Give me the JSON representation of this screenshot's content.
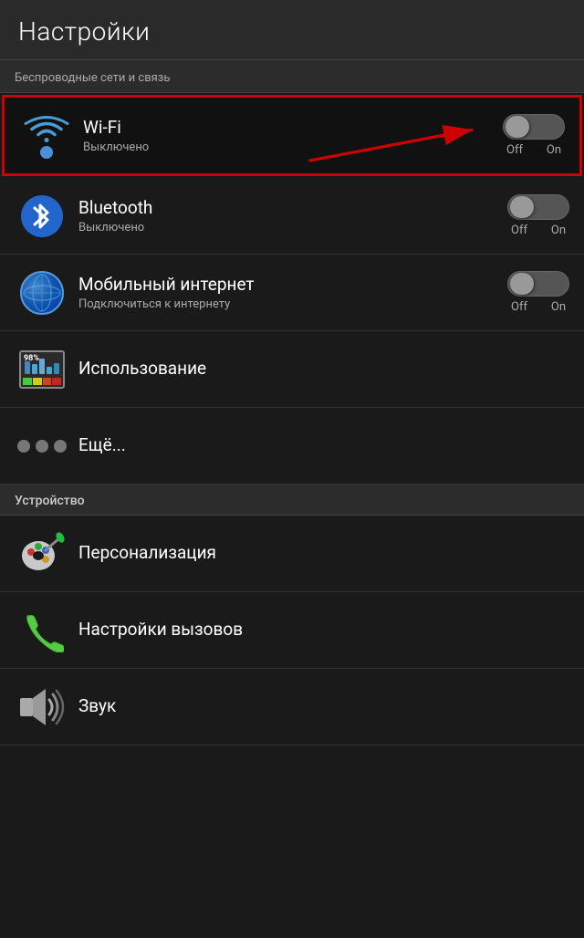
{
  "header": {
    "title": "Настройки"
  },
  "wireless_section": {
    "header": "Беспроводные сети и связь"
  },
  "device_section": {
    "header": "Устройство"
  },
  "items": [
    {
      "id": "wifi",
      "title": "Wi-Fi",
      "subtitle": "Выключено",
      "toggle": true,
      "off_label": "Off",
      "on_label": "On",
      "highlighted": true
    },
    {
      "id": "bluetooth",
      "title": "Bluetooth",
      "subtitle": "Выключено",
      "toggle": true,
      "off_label": "Off",
      "on_label": "On",
      "highlighted": false
    },
    {
      "id": "mobile",
      "title": "Мобильный интернет",
      "subtitle": "Подключиться к интернету",
      "toggle": true,
      "off_label": "Off",
      "on_label": "On",
      "highlighted": false
    },
    {
      "id": "usage",
      "title": "Использование",
      "subtitle": "",
      "toggle": false,
      "highlighted": false
    },
    {
      "id": "more",
      "title": "Ещё...",
      "subtitle": "",
      "toggle": false,
      "highlighted": false
    }
  ],
  "device_items": [
    {
      "id": "personalization",
      "title": "Персонализация",
      "subtitle": "",
      "toggle": false
    },
    {
      "id": "calls",
      "title": "Настройки вызовов",
      "subtitle": "",
      "toggle": false
    },
    {
      "id": "sound",
      "title": "Звук",
      "subtitle": "",
      "toggle": false
    }
  ]
}
